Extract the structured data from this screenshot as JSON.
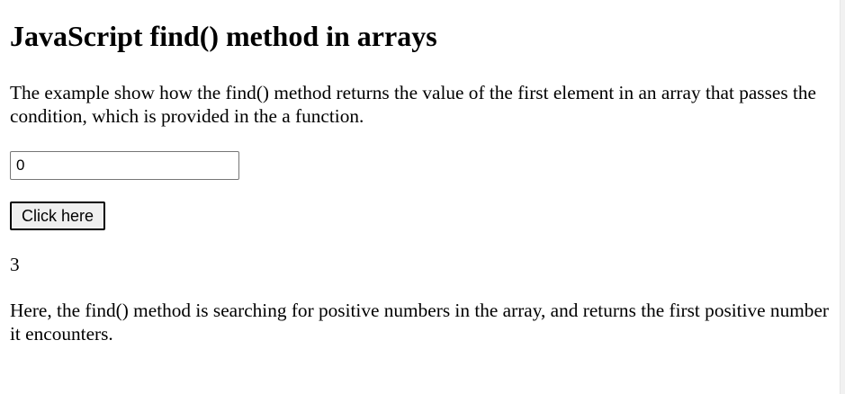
{
  "page": {
    "title": "JavaScript find() method in arrays",
    "description": "The example show how the find() method returns the value of the first element in an array that passes the condition, which is provided in the a function.",
    "input": {
      "value": "0"
    },
    "button_label": "Click here",
    "result": "3",
    "explanation": "Here, the find() method is searching for positive numbers in the array, and returns the first positive number it encounters."
  }
}
